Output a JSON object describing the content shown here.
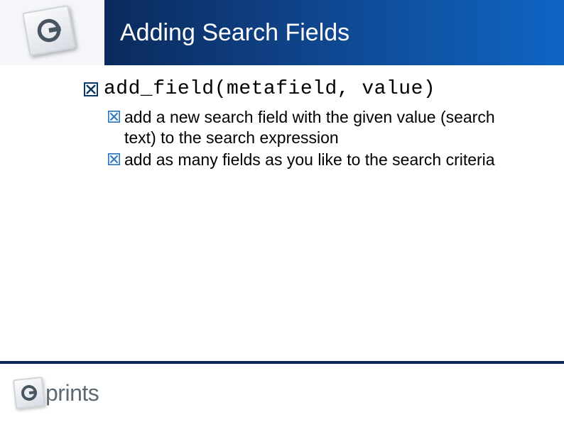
{
  "header": {
    "title": "Adding Search Fields"
  },
  "content": {
    "code_signature": "add_field(metafield, value)",
    "subpoints": [
      "add a new search field with the given value (search text) to the search expression",
      "add as many fields as you like to the search criteria"
    ]
  },
  "footer": {
    "logo_text": "prints"
  },
  "colors": {
    "bullet_dark": "#083a6a",
    "bullet_light": "#2f78c6",
    "titlebar_start": "#0a2a5c",
    "titlebar_end": "#0f65c4"
  }
}
